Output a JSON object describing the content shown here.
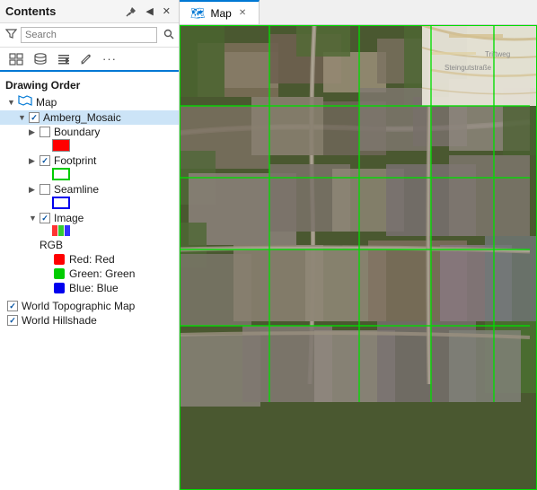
{
  "panel": {
    "title": "Contents",
    "search_placeholder": "Search",
    "pin_tooltip": "Pin",
    "close_tooltip": "Close"
  },
  "toolbar": {
    "items": [
      "list-view",
      "database-icon",
      "filter-layer-icon",
      "pencil-icon",
      "more-options"
    ]
  },
  "drawing_order_label": "Drawing Order",
  "tree": {
    "map_label": "Map",
    "layers": [
      {
        "id": "amberg_mosaic",
        "label": "Amberg_Mosaic",
        "checked": true,
        "expanded": true,
        "children": [
          {
            "id": "boundary",
            "label": "Boundary",
            "checked": false,
            "swatch": "red-fill",
            "expanded": false
          },
          {
            "id": "footprint",
            "label": "Footprint",
            "checked": true,
            "swatch": "green-outline",
            "expanded": false
          },
          {
            "id": "seamline",
            "label": "Seamline",
            "checked": false,
            "swatch": "blue-outline",
            "expanded": false
          },
          {
            "id": "image",
            "label": "Image",
            "checked": true,
            "swatch": "rgb-bars",
            "expanded": true,
            "children": [
              {
                "label": "RGB"
              },
              {
                "label": "Red: Red",
                "dot_color": "#ff0000"
              },
              {
                "label": "Green: Green",
                "dot_color": "#00cc00"
              },
              {
                "label": "Blue: Blue",
                "dot_color": "#0000ee"
              }
            ]
          }
        ]
      },
      {
        "id": "world_topo",
        "label": "World Topographic Map",
        "checked": true
      },
      {
        "id": "world_hillshade",
        "label": "World Hillshade",
        "checked": true
      }
    ]
  },
  "map_tab": {
    "label": "Map",
    "icon": "map-icon"
  }
}
